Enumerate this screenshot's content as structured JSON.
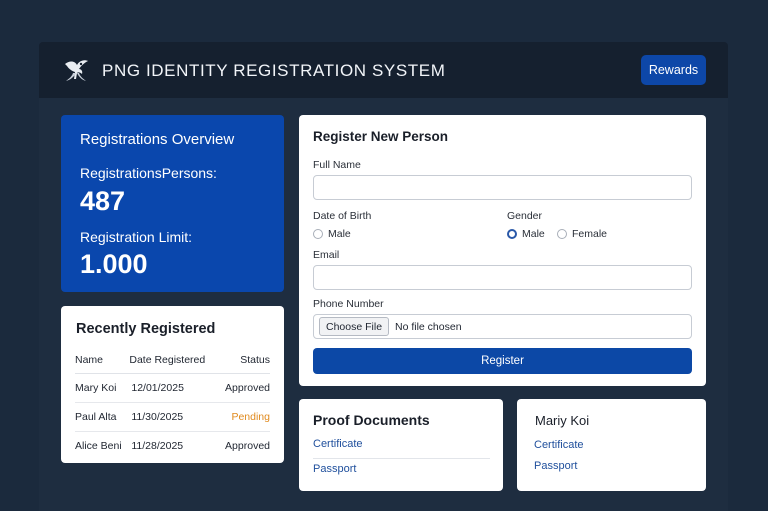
{
  "header": {
    "title": "PNG IDENTITY REGISTRATION SYSTEM",
    "logo_icon": "bird-of-paradise-icon",
    "rewards_label": "Rewards"
  },
  "overview": {
    "title": "Registrations Overview",
    "persons_label": "RegistrationsPersons:",
    "persons_value": "487",
    "limit_label": "Registration Limit:",
    "limit_value": "1.000"
  },
  "recent": {
    "title": "Recently Registered",
    "columns": [
      "Name",
      "Date Registered",
      "Status"
    ],
    "rows": [
      {
        "name": "Mary Koi",
        "date": "12/01/2025",
        "status": "Approved"
      },
      {
        "name": "Paul Alta",
        "date": "11/30/2025",
        "status": "Pending"
      },
      {
        "name": "Alice Beni",
        "date": "11/28/2025",
        "status": "Approved"
      }
    ]
  },
  "register_form": {
    "title": "Register New Person",
    "full_name_label": "Full Name",
    "full_name_value": "",
    "dob_label": "Date of Birth",
    "dob_option": "Male",
    "gender_label": "Gender",
    "gender_options": [
      "Male",
      "Female"
    ],
    "gender_selected": "Male",
    "email_label": "Email",
    "email_value": "",
    "phone_label": "Phone Number",
    "choose_file_label": "Choose File",
    "no_file_text": "No file chosen",
    "submit_label": "Register"
  },
  "proof": {
    "title": "Proof Documents",
    "links": [
      "Certificate",
      "Passport"
    ]
  },
  "person_card": {
    "name": "Mariy Koi",
    "links": [
      "Certificate",
      "Passport"
    ]
  },
  "colors": {
    "page_bg": "#1b2a3d",
    "header_bg": "#15202f",
    "accent": "#0c48a6",
    "status_approved": "#1f2530",
    "status_pending": "#e08a1e",
    "link": "#1f4f9c"
  }
}
